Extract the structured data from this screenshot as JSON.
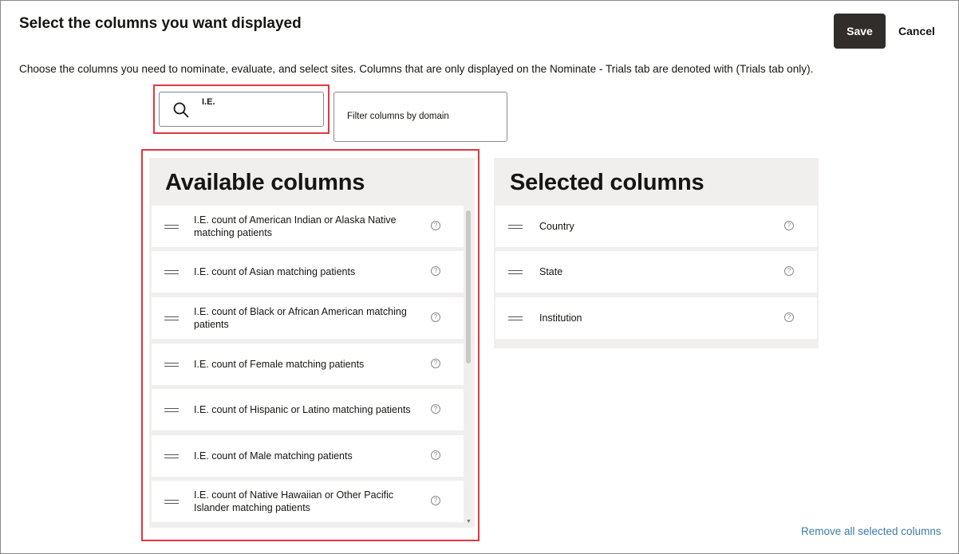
{
  "header": {
    "title": "Select the columns you want displayed",
    "save_label": "Save",
    "cancel_label": "Cancel"
  },
  "description": "Choose the columns you need to nominate, evaluate, and select sites. Columns that are only displayed on the Nominate - Trials tab are denoted with (Trials tab only).",
  "search": {
    "value": "I.E.",
    "icon": "search-icon"
  },
  "domain_filter": {
    "placeholder": "Filter columns by domain"
  },
  "available": {
    "title": "Available columns",
    "items": [
      {
        "line1": "I.E. count of American Indian or Alaska Native",
        "line2": "matching patients"
      },
      {
        "line1": "I.E. count of Asian matching patients",
        "line2": ""
      },
      {
        "line1": "I.E. count of Black or African American matching",
        "line2": "patients"
      },
      {
        "line1": "I.E. count of Female matching patients",
        "line2": ""
      },
      {
        "line1": "I.E. count of Hispanic or Latino matching patients",
        "line2": ""
      },
      {
        "line1": "I.E. count of Male matching patients",
        "line2": ""
      },
      {
        "line1": "I.E. count of Native Hawaiian or Other Pacific",
        "line2": "Islander matching patients"
      }
    ]
  },
  "selected": {
    "title": "Selected columns",
    "items": [
      {
        "label": "Country"
      },
      {
        "label": "State"
      },
      {
        "label": "Institution"
      }
    ]
  },
  "help_glyph": "?",
  "remove_all_label": "Remove all selected columns",
  "colors": {
    "highlight": "#e0393e",
    "primary_button": "#312d2a",
    "link": "#3d7ba8",
    "panel_bg": "#f1efed"
  }
}
